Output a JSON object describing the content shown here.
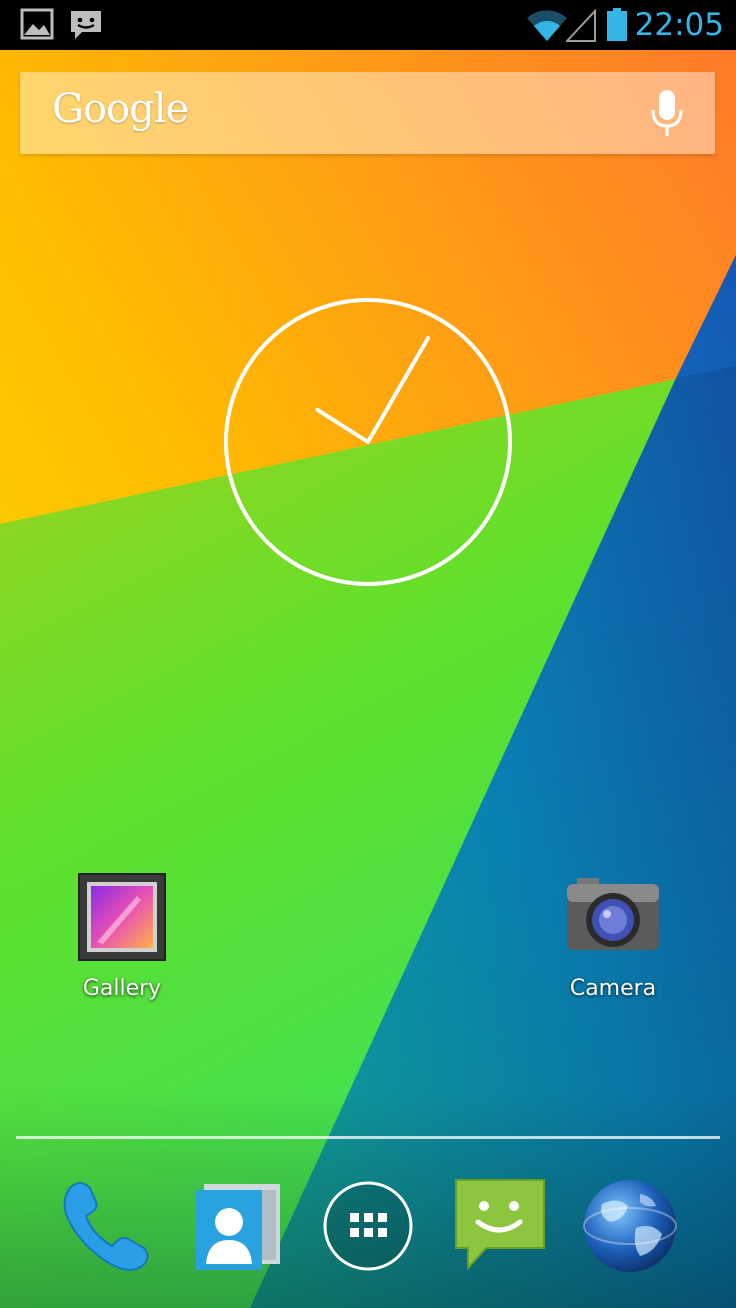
{
  "status_bar": {
    "time": "22:05",
    "notification_icons": [
      "gallery-notification-icon",
      "message-notification-icon"
    ],
    "indicators": [
      "wifi-icon",
      "cell-signal-icon",
      "battery-icon"
    ],
    "accent_color": "#33b5e5"
  },
  "search": {
    "logo_text": "Google",
    "mic_icon": "microphone-icon"
  },
  "clock": {
    "hour": 10,
    "minute": 5
  },
  "shortcuts": [
    {
      "label": "Gallery",
      "icon": "gallery-icon"
    },
    {
      "label": "Camera",
      "icon": "camera-icon"
    }
  ],
  "dock": [
    {
      "icon": "phone-icon"
    },
    {
      "icon": "contacts-icon"
    },
    {
      "icon": "app-drawer-icon"
    },
    {
      "icon": "messaging-icon"
    },
    {
      "icon": "browser-globe-icon"
    }
  ]
}
